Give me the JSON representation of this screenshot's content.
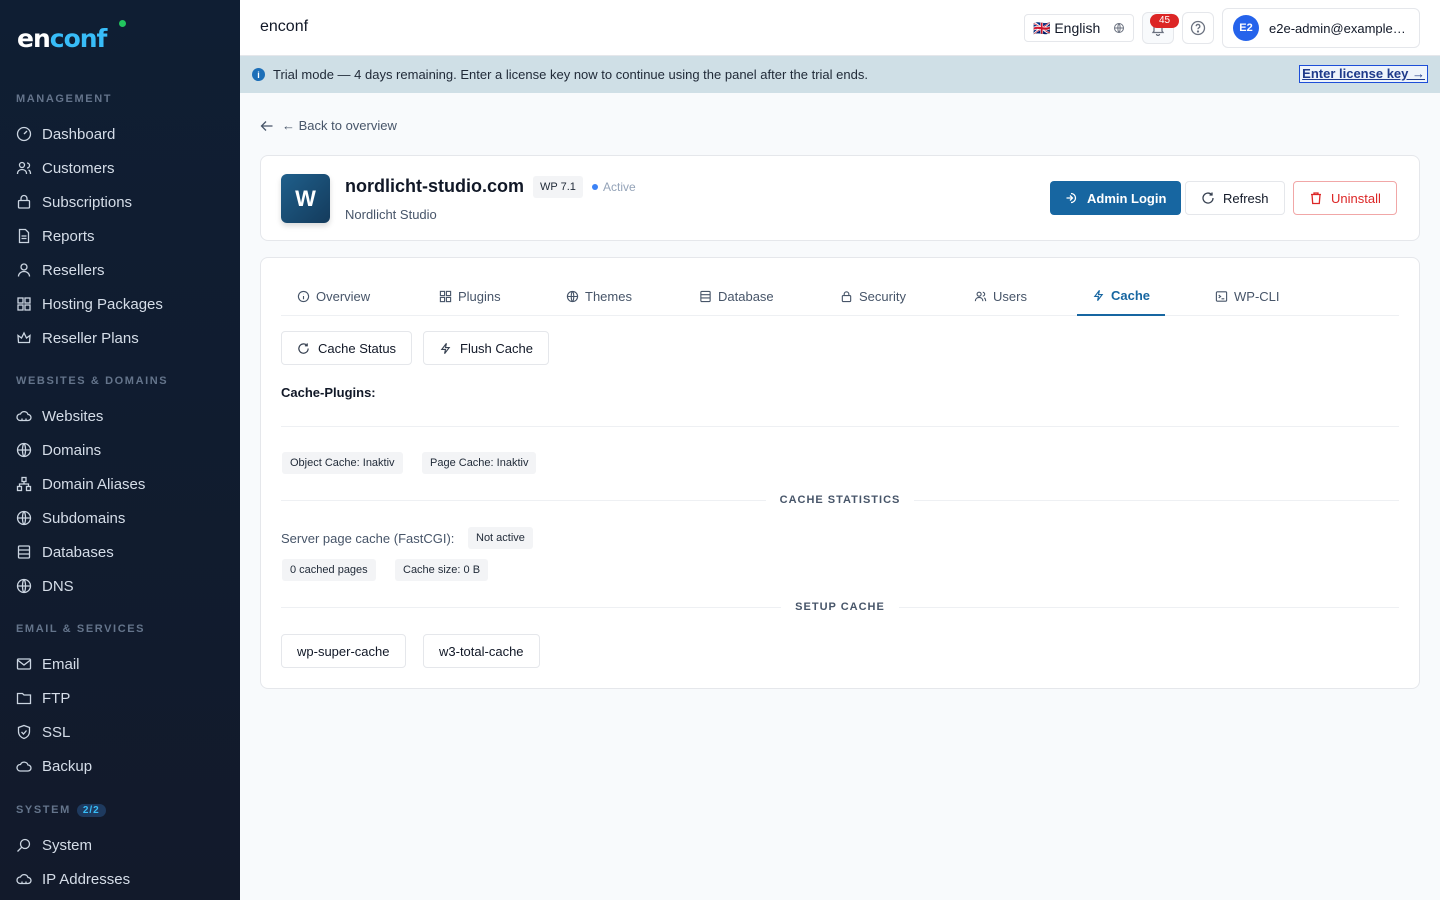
{
  "app": {
    "logo_left": "en",
    "logo_right": "conf",
    "top_brand": "enconf"
  },
  "sidebar": {
    "sections": {
      "management": "MANAGEMENT",
      "websites": "WEBSITES & DOMAINS",
      "email": "EMAIL & SERVICES",
      "system": "SYSTEM",
      "system_badge": "2/2"
    },
    "items": {
      "dashboard": "Dashboard",
      "customers": "Customers",
      "subscriptions": "Subscriptions",
      "reports": "Reports",
      "resellers": "Resellers",
      "hosting_packages": "Hosting Packages",
      "reseller_plans": "Reseller Plans",
      "websites": "Websites",
      "domains": "Domains",
      "domain_aliases": "Domain Aliases",
      "subdomains": "Subdomains",
      "databases": "Databases",
      "dns": "DNS",
      "email": "Email",
      "ftp": "FTP",
      "ssl": "SSL",
      "backup": "Backup",
      "system": "System",
      "ip_addresses": "IP Addresses"
    }
  },
  "topbar": {
    "language": "🇬🇧 English",
    "notification_count": "45",
    "user_initials": "E2",
    "user_email": "e2e-admin@example…"
  },
  "banner": {
    "message": "Trial mode — 4 days remaining. Enter a license key now to continue using the panel after the trial ends.",
    "license_link": "Enter license key →"
  },
  "main": {
    "back_link": "← Back to overview",
    "site": {
      "initial": "W",
      "domain": "nordlicht-studio.com",
      "wp_version": "WP 7.1",
      "status": "Active",
      "company": "Nordlicht Studio"
    },
    "actions": {
      "admin_login": "Admin Login",
      "refresh": "Refresh",
      "uninstall": "Uninstall"
    },
    "tabs": {
      "overview": "Overview",
      "plugins": "Plugins",
      "themes": "Themes",
      "database": "Database",
      "security": "Security",
      "users": "Users",
      "cache": "Cache",
      "wpcli": "WP-CLI"
    },
    "cache": {
      "status_button": "Cache Status",
      "flush_button": "Flush Cache",
      "plugins_label": "Cache-Plugins:",
      "object_cache": "Object Cache: Inaktiv",
      "page_cache": "Page Cache: Inaktiv",
      "stats_heading": "CACHE STATISTICS",
      "server_cache_label": "Server page cache (FastCGI):",
      "server_cache_value": "Not active",
      "cached_pages": "0 cached pages",
      "cache_size": "Cache size: 0 B",
      "setup_heading": "SETUP CACHE",
      "setup_options": [
        "wp-super-cache",
        "w3-total-cache"
      ]
    }
  },
  "colors": {
    "accent": "#1766a1",
    "danger": "#dc2626",
    "sidebar_bg": "#0f1e33",
    "banner_bg": "#cfdfe6"
  }
}
